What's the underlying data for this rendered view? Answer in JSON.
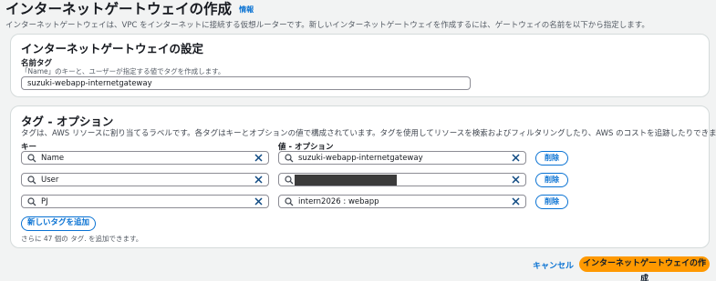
{
  "header": {
    "title": "インターネットゲートウェイの作成",
    "info_link": "情報",
    "description": "インターネットゲートウェイは、VPC をインターネットに接続する仮想ルーターです。新しいインターネットゲートウェイを作成するには、ゲートウェイの名前を以下から指定します。"
  },
  "settings": {
    "heading": "インターネットゲートウェイの設定",
    "name_label": "名前タグ",
    "name_desc": "「Name」のキーと、ユーザーが指定する値でタグを作成します。",
    "name_value": "suzuki-webapp-internetgateway"
  },
  "tags": {
    "heading": "タグ - オプション",
    "description": "タグは、AWS リソースに割り当てるラベルです。各タグはキーとオプションの値で構成されています。タグを使用してリソースを検索およびフィルタリングしたり、AWS のコストを追跡したりできます。",
    "key_label": "キー",
    "value_label": "値 - オプション",
    "rows": [
      {
        "key": "Name",
        "value": "suzuki-webapp-internetgateway",
        "remove_label": "削除"
      },
      {
        "key": "User",
        "value": "",
        "remove_label": "削除"
      },
      {
        "key": "PJ",
        "value": "intern2026 : webapp",
        "remove_label": "削除"
      }
    ],
    "add_label": "新しいタグを追加",
    "limit_note": "さらに 47 個の タグ. を追加できます。"
  },
  "footer": {
    "cancel_label": "キャンセル",
    "create_label": "インターネットゲートウェイの作成"
  },
  "colors": {
    "accent": "#0972d3",
    "primary_button": "#ff9900",
    "background": "#f2f3f3"
  },
  "icons": {
    "search": "search-icon",
    "clear": "close-icon"
  }
}
